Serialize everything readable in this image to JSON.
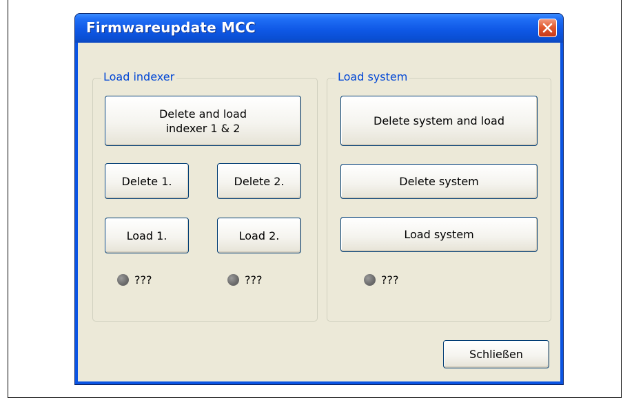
{
  "window": {
    "title": "Firmwareupdate MCC",
    "close_icon": "close-icon"
  },
  "load_indexer": {
    "legend": "Load indexer",
    "delete_and_load": "Delete and load\nindexer 1 & 2",
    "delete_1": "Delete 1.",
    "delete_2": "Delete 2.",
    "load_1": "Load 1.",
    "load_2": "Load 2.",
    "status_1": "???",
    "status_2": "???"
  },
  "load_system": {
    "legend": "Load system",
    "delete_and_load": "Delete system and load",
    "delete": "Delete system",
    "load": "Load system",
    "status": "???"
  },
  "footer": {
    "close_label": "Schließen"
  },
  "colors": {
    "titlebar": "#0a54e3",
    "legend_text": "#0046d5",
    "led": "#6e6e6e"
  }
}
